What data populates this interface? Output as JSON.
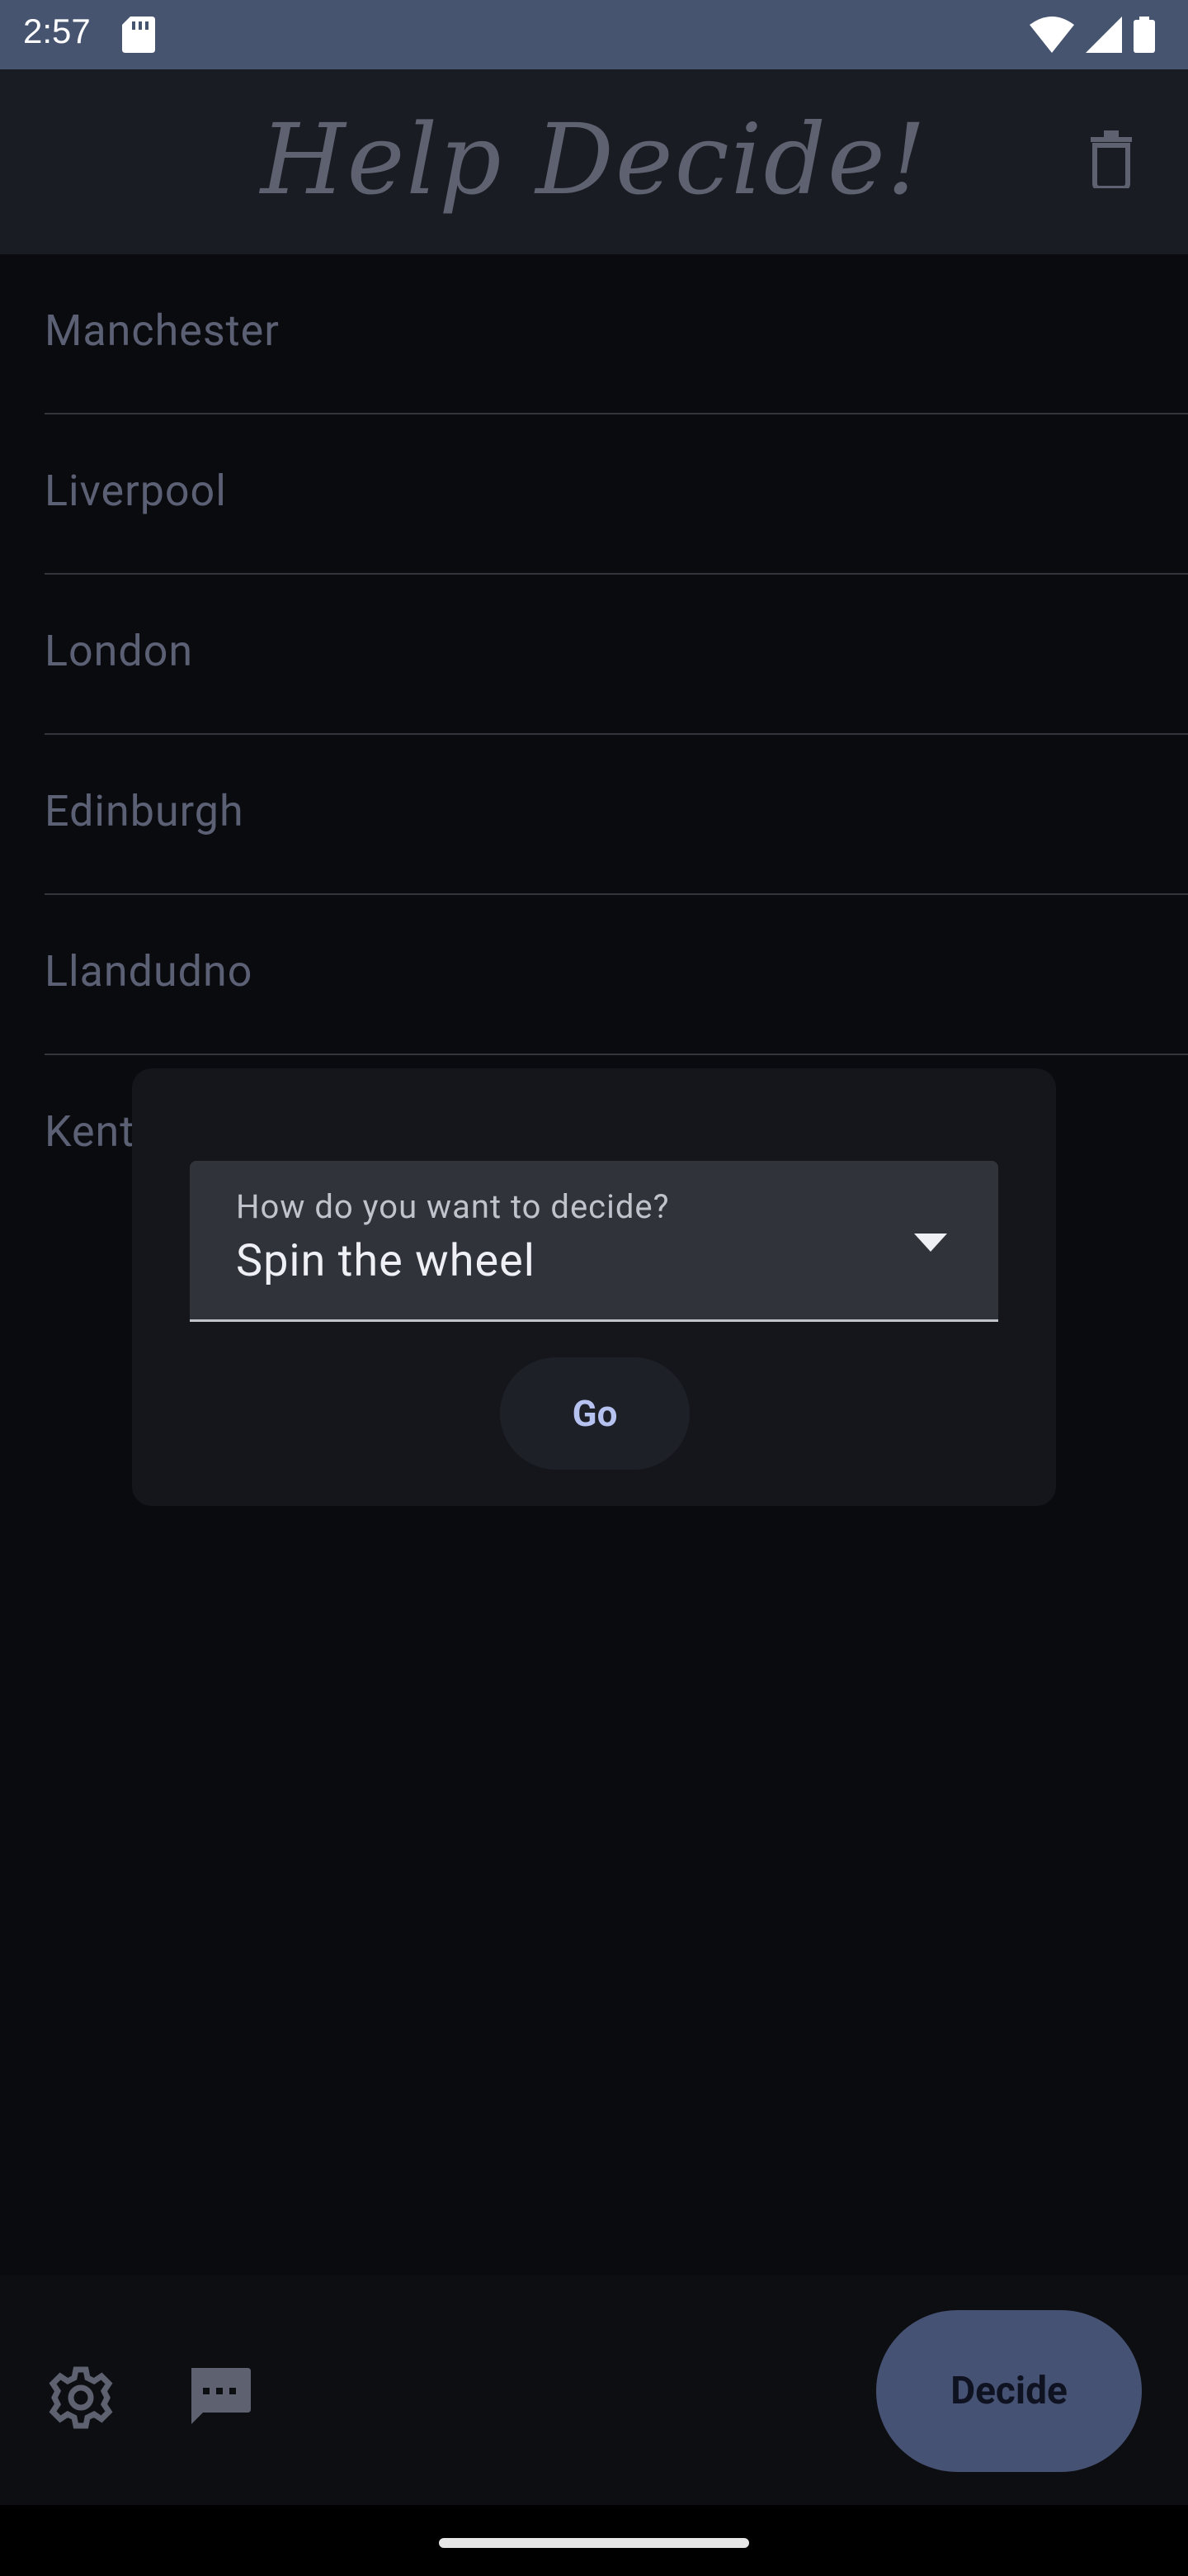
{
  "status_bar": {
    "time": "2:57"
  },
  "app_bar": {
    "title": "Help Decide!"
  },
  "list": {
    "items": [
      {
        "label": "Manchester"
      },
      {
        "label": "Liverpool"
      },
      {
        "label": "London"
      },
      {
        "label": "Edinburgh"
      },
      {
        "label": "Llandudno"
      },
      {
        "label": "Kent"
      }
    ]
  },
  "dialog": {
    "select_label": "How do you want to decide?",
    "select_value": "Spin the wheel",
    "go_label": "Go"
  },
  "bottom_bar": {
    "decide_label": "Decide"
  },
  "colors": {
    "accent": "#465273",
    "status_bar": "#475470",
    "background": "#0a0b0f"
  }
}
